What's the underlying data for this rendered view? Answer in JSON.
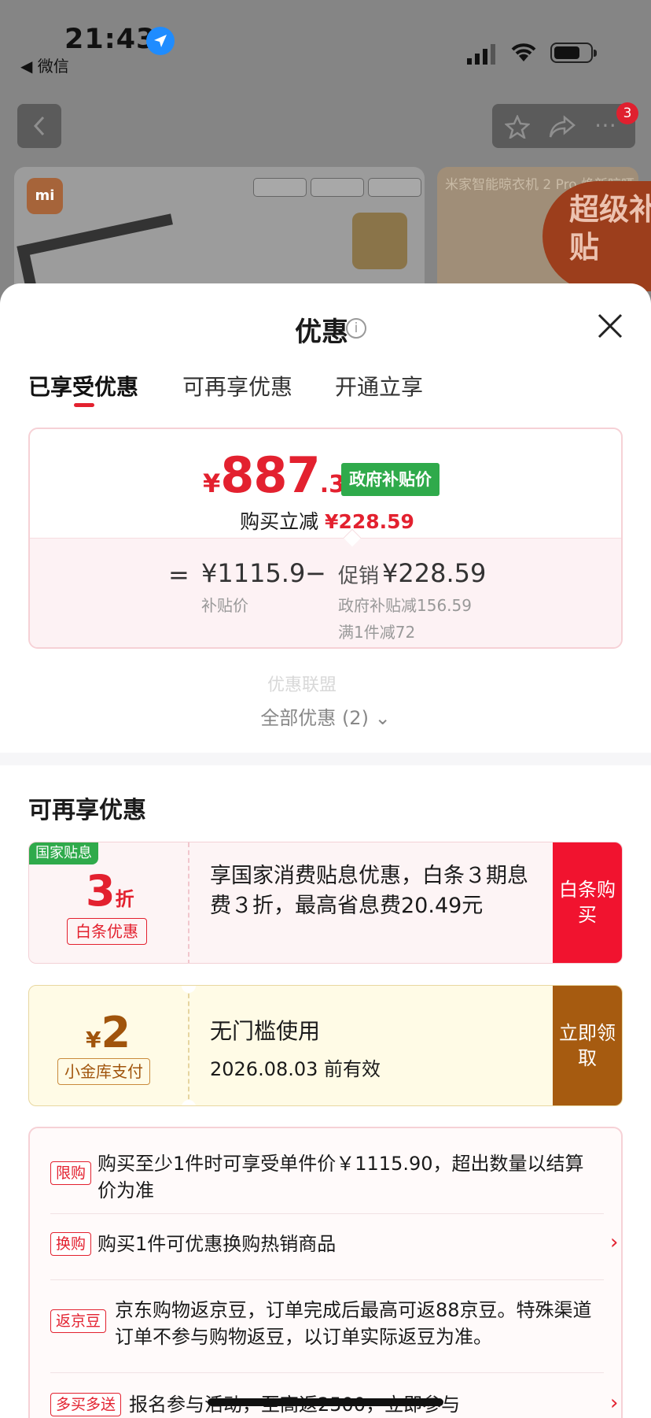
{
  "status_bar": {
    "time": "21:43",
    "back_app": "◀ 微信"
  },
  "nav": {
    "badge_count": "3"
  },
  "product": {
    "brand": "mi",
    "second_title": "米家智能晾衣机 2 Pro 焕新晾晒",
    "super_subsidy": "超级补贴"
  },
  "sheet": {
    "title": "优惠",
    "tabs": [
      {
        "label": "已享受优惠",
        "active": true
      },
      {
        "label": "可再享优惠",
        "active": false
      },
      {
        "label": "开通立享",
        "active": false
      }
    ],
    "price_card": {
      "currency": "¥",
      "price_int": "887",
      "price_dec": ".31",
      "gov_tag": "政府补贴价",
      "reduce_label": "购买立减",
      "reduce_value": "¥228.59",
      "equals": "=",
      "base_price": "¥1115.9",
      "base_label": "补贴价",
      "minus": "−",
      "promo_label": "促销",
      "promo_value": "¥228.59",
      "promo_detail_1": "政府补贴减156.59",
      "promo_detail_2": "满1件减72"
    },
    "watermark": "优惠联盟",
    "all_discounts": "全部优惠 (2)",
    "section_title": "可再享优惠",
    "coupon_interest": {
      "tag": "国家贴息",
      "big_num": "3",
      "big_unit": "折",
      "chip": "白条优惠",
      "desc": "享国家消费贴息优惠，白条３期息费３折，最高省息费20.49元",
      "button": "白条购买"
    },
    "coupon_cash": {
      "currency": "¥",
      "amount": "2",
      "chip": "小金库支付",
      "title": "无门槛使用",
      "validity": "2026.08.03 前有效",
      "button": "立即领取"
    },
    "rules": [
      {
        "tag": "限购",
        "text": "购买至少1件时可享受单件价￥1115.90，超出数量以结算价为准"
      },
      {
        "tag": "换购",
        "text": "购买1件可优惠换购热销商品"
      },
      {
        "tag": "返京豆",
        "text": "京东购物返京豆，订单完成后最高可返88京豆。特殊渠道订单不参与购物返豆，以订单实际返豆为准。"
      },
      {
        "tag": "多买多送",
        "text": "报名参与活动，至高返2500，立即参与"
      }
    ]
  }
}
